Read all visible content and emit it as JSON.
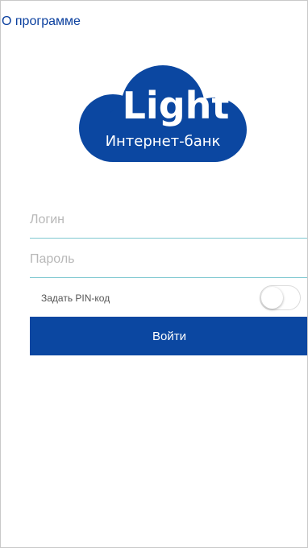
{
  "header": {
    "about_link": "О программе"
  },
  "logo": {
    "brand": "Light",
    "tagline": "Интернет-банк",
    "color": "#0b47a1"
  },
  "form": {
    "login_placeholder": "Логин",
    "login_value": "",
    "password_placeholder": "Пароль",
    "password_value": "",
    "pin_label": "Задать PIN-код",
    "pin_enabled": false,
    "submit_label": "Войти"
  },
  "colors": {
    "accent": "#0b47a1",
    "link": "#0a3f9e",
    "field_underline": "#7fc8d0"
  }
}
